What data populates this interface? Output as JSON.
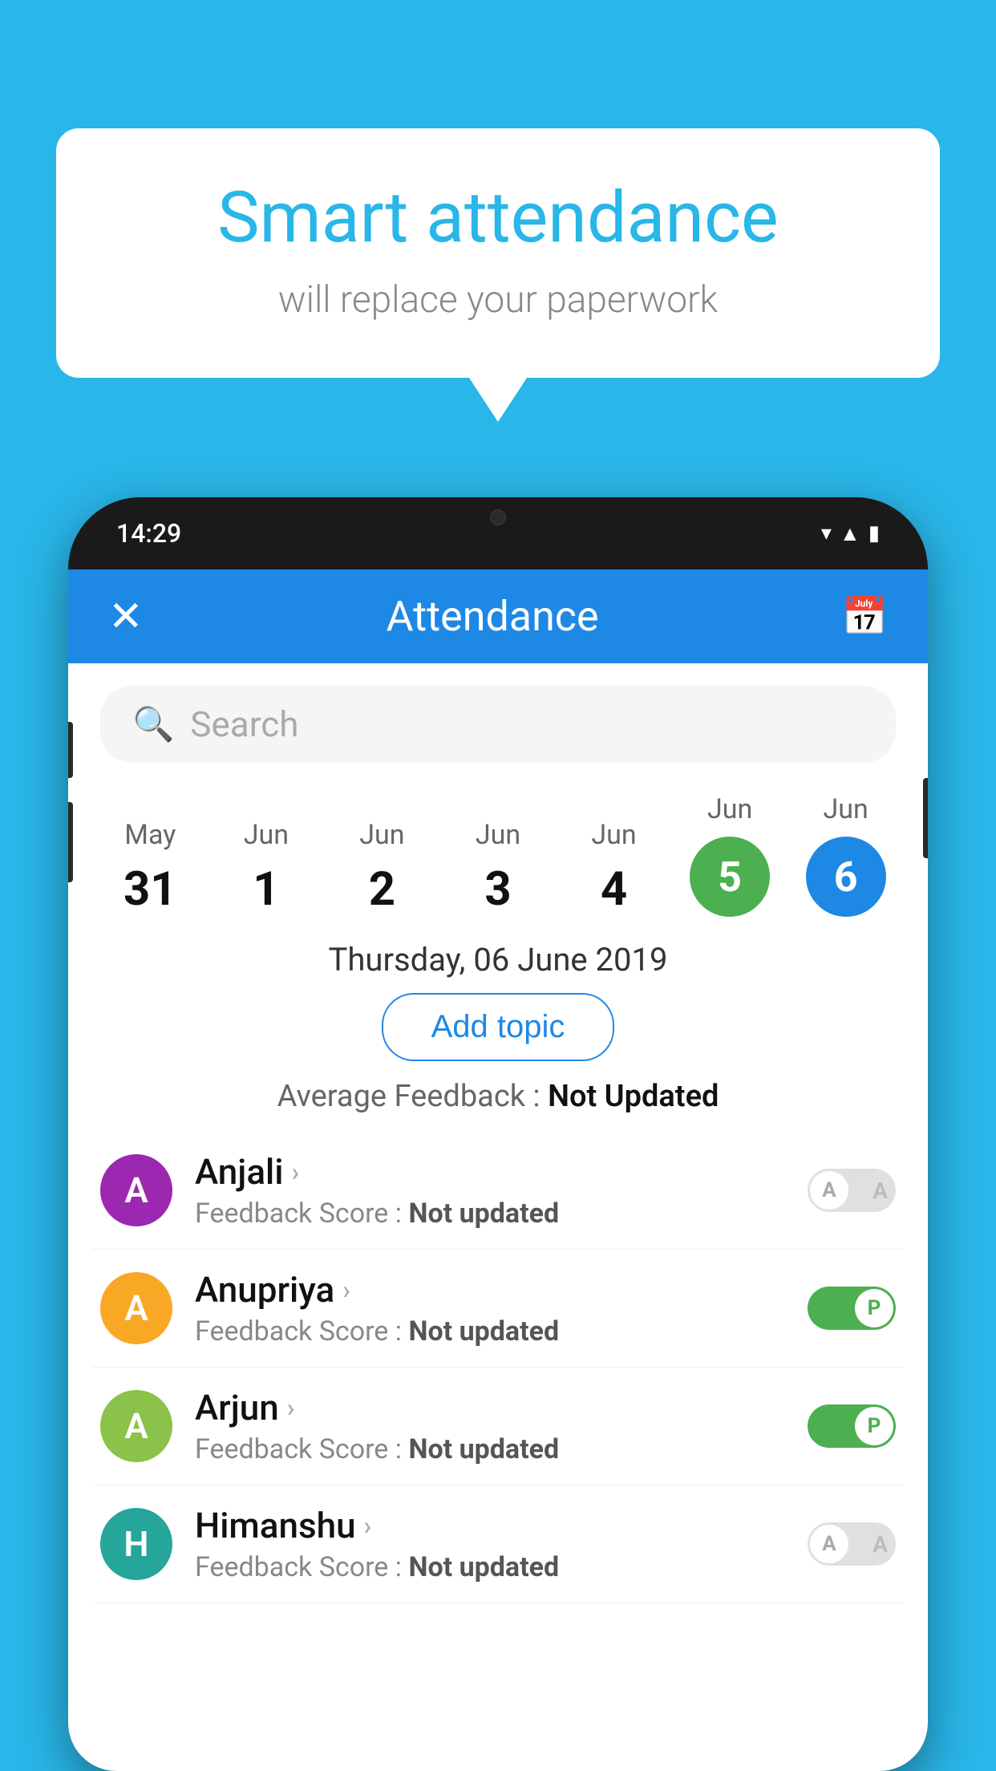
{
  "background_color": "#29b6e8",
  "bubble": {
    "title": "Smart attendance",
    "subtitle": "will replace your paperwork"
  },
  "app": {
    "status_time": "14:29",
    "header_title": "Attendance",
    "close_label": "✕",
    "calendar_icon": "📅",
    "search_placeholder": "Search"
  },
  "calendar": {
    "dates": [
      {
        "month": "May",
        "day": "31",
        "selected": ""
      },
      {
        "month": "Jun",
        "day": "1",
        "selected": ""
      },
      {
        "month": "Jun",
        "day": "2",
        "selected": ""
      },
      {
        "month": "Jun",
        "day": "3",
        "selected": ""
      },
      {
        "month": "Jun",
        "day": "4",
        "selected": ""
      },
      {
        "month": "Jun",
        "day": "5",
        "selected": "green"
      },
      {
        "month": "Jun",
        "day": "6",
        "selected": "blue"
      }
    ],
    "selected_date_label": "Thursday, 06 June 2019"
  },
  "add_topic_button": "Add topic",
  "avg_feedback_label": "Average Feedback : ",
  "avg_feedback_value": "Not Updated",
  "students": [
    {
      "name": "Anjali",
      "avatar_letter": "A",
      "avatar_color": "purple",
      "feedback": "Feedback Score : ",
      "feedback_value": "Not updated",
      "attendance": "absent"
    },
    {
      "name": "Anupriya",
      "avatar_letter": "A",
      "avatar_color": "yellow",
      "feedback": "Feedback Score : ",
      "feedback_value": "Not updated",
      "attendance": "present"
    },
    {
      "name": "Arjun",
      "avatar_letter": "A",
      "avatar_color": "light-green",
      "feedback": "Feedback Score : ",
      "feedback_value": "Not updated",
      "attendance": "present"
    },
    {
      "name": "Himanshu",
      "avatar_letter": "H",
      "avatar_color": "teal",
      "feedback": "Feedback Score : ",
      "feedback_value": "Not updated",
      "attendance": "absent"
    }
  ]
}
